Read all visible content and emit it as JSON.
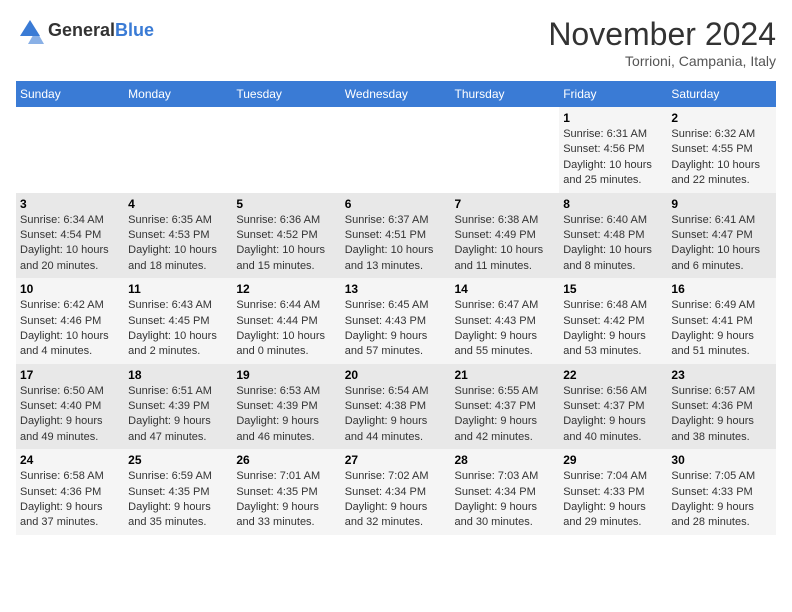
{
  "logo": {
    "text_general": "General",
    "text_blue": "Blue"
  },
  "title": {
    "month": "November 2024",
    "location": "Torrioni, Campania, Italy"
  },
  "days_of_week": [
    "Sunday",
    "Monday",
    "Tuesday",
    "Wednesday",
    "Thursday",
    "Friday",
    "Saturday"
  ],
  "weeks": [
    [
      {
        "day": "",
        "info": ""
      },
      {
        "day": "",
        "info": ""
      },
      {
        "day": "",
        "info": ""
      },
      {
        "day": "",
        "info": ""
      },
      {
        "day": "",
        "info": ""
      },
      {
        "day": "1",
        "info": "Sunrise: 6:31 AM\nSunset: 4:56 PM\nDaylight: 10 hours and 25 minutes."
      },
      {
        "day": "2",
        "info": "Sunrise: 6:32 AM\nSunset: 4:55 PM\nDaylight: 10 hours and 22 minutes."
      }
    ],
    [
      {
        "day": "3",
        "info": "Sunrise: 6:34 AM\nSunset: 4:54 PM\nDaylight: 10 hours and 20 minutes."
      },
      {
        "day": "4",
        "info": "Sunrise: 6:35 AM\nSunset: 4:53 PM\nDaylight: 10 hours and 18 minutes."
      },
      {
        "day": "5",
        "info": "Sunrise: 6:36 AM\nSunset: 4:52 PM\nDaylight: 10 hours and 15 minutes."
      },
      {
        "day": "6",
        "info": "Sunrise: 6:37 AM\nSunset: 4:51 PM\nDaylight: 10 hours and 13 minutes."
      },
      {
        "day": "7",
        "info": "Sunrise: 6:38 AM\nSunset: 4:49 PM\nDaylight: 10 hours and 11 minutes."
      },
      {
        "day": "8",
        "info": "Sunrise: 6:40 AM\nSunset: 4:48 PM\nDaylight: 10 hours and 8 minutes."
      },
      {
        "day": "9",
        "info": "Sunrise: 6:41 AM\nSunset: 4:47 PM\nDaylight: 10 hours and 6 minutes."
      }
    ],
    [
      {
        "day": "10",
        "info": "Sunrise: 6:42 AM\nSunset: 4:46 PM\nDaylight: 10 hours and 4 minutes."
      },
      {
        "day": "11",
        "info": "Sunrise: 6:43 AM\nSunset: 4:45 PM\nDaylight: 10 hours and 2 minutes."
      },
      {
        "day": "12",
        "info": "Sunrise: 6:44 AM\nSunset: 4:44 PM\nDaylight: 10 hours and 0 minutes."
      },
      {
        "day": "13",
        "info": "Sunrise: 6:45 AM\nSunset: 4:43 PM\nDaylight: 9 hours and 57 minutes."
      },
      {
        "day": "14",
        "info": "Sunrise: 6:47 AM\nSunset: 4:43 PM\nDaylight: 9 hours and 55 minutes."
      },
      {
        "day": "15",
        "info": "Sunrise: 6:48 AM\nSunset: 4:42 PM\nDaylight: 9 hours and 53 minutes."
      },
      {
        "day": "16",
        "info": "Sunrise: 6:49 AM\nSunset: 4:41 PM\nDaylight: 9 hours and 51 minutes."
      }
    ],
    [
      {
        "day": "17",
        "info": "Sunrise: 6:50 AM\nSunset: 4:40 PM\nDaylight: 9 hours and 49 minutes."
      },
      {
        "day": "18",
        "info": "Sunrise: 6:51 AM\nSunset: 4:39 PM\nDaylight: 9 hours and 47 minutes."
      },
      {
        "day": "19",
        "info": "Sunrise: 6:53 AM\nSunset: 4:39 PM\nDaylight: 9 hours and 46 minutes."
      },
      {
        "day": "20",
        "info": "Sunrise: 6:54 AM\nSunset: 4:38 PM\nDaylight: 9 hours and 44 minutes."
      },
      {
        "day": "21",
        "info": "Sunrise: 6:55 AM\nSunset: 4:37 PM\nDaylight: 9 hours and 42 minutes."
      },
      {
        "day": "22",
        "info": "Sunrise: 6:56 AM\nSunset: 4:37 PM\nDaylight: 9 hours and 40 minutes."
      },
      {
        "day": "23",
        "info": "Sunrise: 6:57 AM\nSunset: 4:36 PM\nDaylight: 9 hours and 38 minutes."
      }
    ],
    [
      {
        "day": "24",
        "info": "Sunrise: 6:58 AM\nSunset: 4:36 PM\nDaylight: 9 hours and 37 minutes."
      },
      {
        "day": "25",
        "info": "Sunrise: 6:59 AM\nSunset: 4:35 PM\nDaylight: 9 hours and 35 minutes."
      },
      {
        "day": "26",
        "info": "Sunrise: 7:01 AM\nSunset: 4:35 PM\nDaylight: 9 hours and 33 minutes."
      },
      {
        "day": "27",
        "info": "Sunrise: 7:02 AM\nSunset: 4:34 PM\nDaylight: 9 hours and 32 minutes."
      },
      {
        "day": "28",
        "info": "Sunrise: 7:03 AM\nSunset: 4:34 PM\nDaylight: 9 hours and 30 minutes."
      },
      {
        "day": "29",
        "info": "Sunrise: 7:04 AM\nSunset: 4:33 PM\nDaylight: 9 hours and 29 minutes."
      },
      {
        "day": "30",
        "info": "Sunrise: 7:05 AM\nSunset: 4:33 PM\nDaylight: 9 hours and 28 minutes."
      }
    ]
  ]
}
